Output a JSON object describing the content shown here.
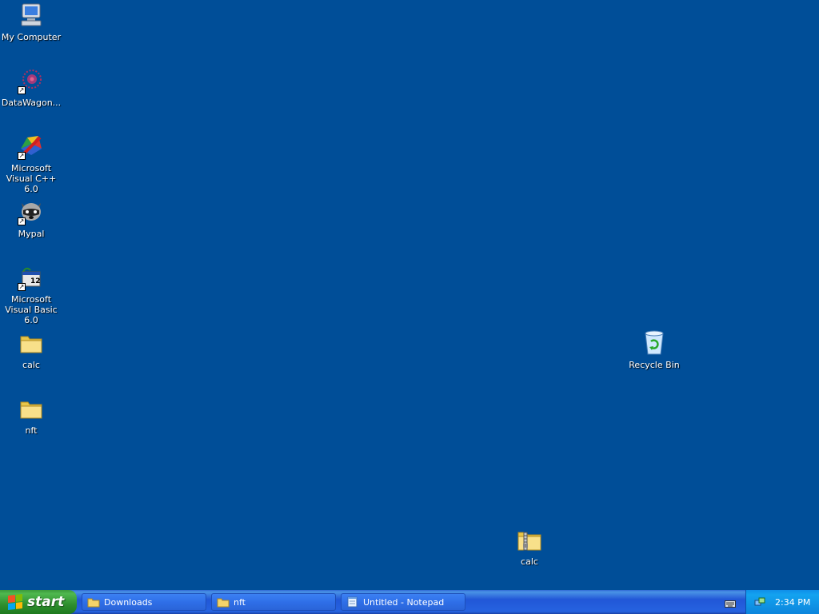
{
  "desktop": {
    "background": "#004e98",
    "icons": [
      {
        "label": "My Computer",
        "icon": "computer-icon"
      },
      {
        "label": "DataWagon...",
        "icon": "datawagon-icon"
      },
      {
        "label": "Microsoft Visual C++ 6.0",
        "icon": "visual-cpp-icon"
      },
      {
        "label": "Mypal",
        "icon": "mypal-icon"
      },
      {
        "label": "Microsoft Visual Basic 6.0",
        "icon": "visual-basic-icon"
      },
      {
        "label": "calc",
        "icon": "folder-icon"
      },
      {
        "label": "nft",
        "icon": "folder-icon"
      },
      {
        "label": "Recycle Bin",
        "icon": "recycle-bin-icon"
      },
      {
        "label": "calc",
        "icon": "zip-folder-icon"
      }
    ]
  },
  "taskbar": {
    "start_label": "start",
    "tasks": [
      {
        "label": "Downloads",
        "icon": "folder-icon"
      },
      {
        "label": "nft",
        "icon": "folder-icon"
      },
      {
        "label": "Untitled - Notepad",
        "icon": "notepad-icon"
      }
    ],
    "tray": {
      "time": "2:34 PM"
    }
  }
}
